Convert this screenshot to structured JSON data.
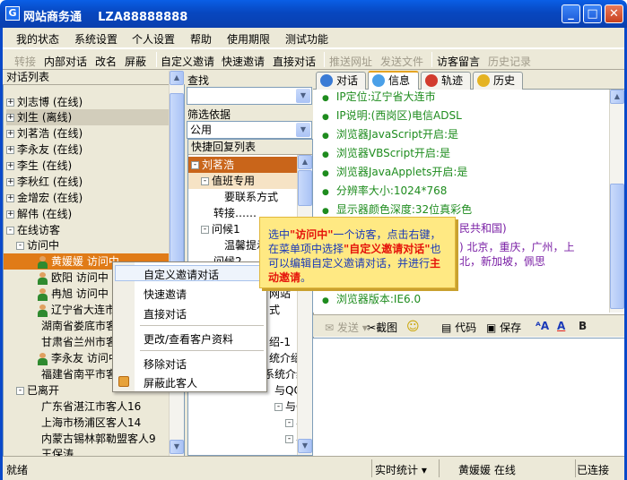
{
  "window": {
    "logo": "G",
    "title": "网站商务通    LZA88888888",
    "minimize": "_",
    "maximize": "□",
    "close": "✕"
  },
  "menu": [
    "我的状态",
    "系统设置",
    "个人设置",
    "帮助",
    "使用期限",
    "测试功能"
  ],
  "toolbar": {
    "transfer": "转接",
    "internal_chat": "内部对话",
    "rename": "改名",
    "block": "屏蔽",
    "custom_invite": "自定义邀请",
    "quick_invite": "快速邀请",
    "direct_chat": "直接对话",
    "push_url": "推送网址",
    "send_file": "发送文件",
    "visitor_msg": "访客留言",
    "history": "历史记录"
  },
  "left_panel": {
    "header": "对话列表",
    "rows": [
      {
        "label": "刘志博 (在线)",
        "exp": "+"
      },
      {
        "label": "刘生 (离线)",
        "exp": "+"
      },
      {
        "label": "刘茗浩 (在线)",
        "exp": "+"
      },
      {
        "label": "李永友 (在线)",
        "exp": "+"
      },
      {
        "label": "李生 (在线)",
        "exp": "+"
      },
      {
        "label": "李秋红 (在线)",
        "exp": "+"
      },
      {
        "label": "金增宏 (在线)",
        "exp": "+"
      },
      {
        "label": "解伟 (在线)",
        "exp": "+"
      },
      {
        "label": "在线访客",
        "exp": "-"
      },
      {
        "label": "访问中",
        "exp": "-"
      },
      {
        "label": "黄媛媛 访问中",
        "exp": ""
      },
      {
        "label": "欧阳 访问中",
        "exp": ""
      },
      {
        "label": "冉旭 访问中",
        "exp": ""
      },
      {
        "label": "辽宁省大连市",
        "exp": ""
      },
      {
        "label": "湖南省娄底市客人",
        "exp": ""
      },
      {
        "label": "甘肃省兰州市客人",
        "exp": ""
      },
      {
        "label": "李永友 访问中",
        "exp": ""
      },
      {
        "label": "福建省南平市客人",
        "exp": ""
      },
      {
        "label": "已离开",
        "exp": "-"
      },
      {
        "label": "广东省湛江市客人16",
        "exp": ""
      },
      {
        "label": "上海市杨浦区客人14",
        "exp": ""
      },
      {
        "label": "内蒙古锡林郭勒盟客人9",
        "exp": ""
      },
      {
        "label": "王保涛",
        "exp": ""
      }
    ]
  },
  "middle_panel": {
    "search_label": "查找",
    "search_value": "",
    "filter_label": "筛选依据",
    "filter_value": "公用",
    "quick_header": "快捷回复列表",
    "quick_rows": [
      "刘茗浩",
      "值班专用",
      "要联系方式",
      "转接……",
      "问候1",
      "温馨提示",
      "问候2",
      "网站",
      "式",
      "绍-1",
      "统介绍-2",
      "系统介绍-",
      "与QQ和M",
      "与QQ的",
      "与",
      "与"
    ]
  },
  "tabs": [
    "对话",
    "信息",
    "轨迹",
    "历史"
  ],
  "info_lines": [
    "IP定位:辽宁省大连市",
    "IP说明:(西岗区)电信ADSL",
    "浏览器JavaScript开启:是",
    "浏览器VBScript开启:是",
    "浏览器JavaApplets开启:是",
    "分辨率大小:1024*768",
    "显示器颜色深度:32位真彩色",
    "民共和国)",
    ") 北京，重庆，广州，上",
    "北，新加坡，佩思",
    "浏览器版本:IE6.0"
  ],
  "edit_toolbar": {
    "send": "发送",
    "screenshot": "截图",
    "code": "代码",
    "save": "保存",
    "bold": "B"
  },
  "context_menu": [
    "自定义邀请对话",
    "快速邀请",
    "直接对话",
    "更改/查看客户资料",
    "移除对话",
    "屏蔽此客人"
  ],
  "tooltip": {
    "p1": "选中",
    "h1": "\"访问中\"",
    "p2": "一个访客，点击右键，在菜单项中选择",
    "h2": "\"自定义邀请对话\"",
    "p3": "也可以编辑自定义邀请对话，并进行",
    "h3": "主动邀请",
    "p4": "。"
  },
  "status": {
    "ready": "就绪",
    "stats": "实时统计",
    "user": "黄媛媛 在线",
    "connected": "已连接"
  },
  "colors": {
    "titlebar": "#0747c0",
    "selected_row": "#e07b17",
    "info_text": "#1e8c1e",
    "tooltip_bg": "#ffe983",
    "highlight": "#e5140b"
  }
}
